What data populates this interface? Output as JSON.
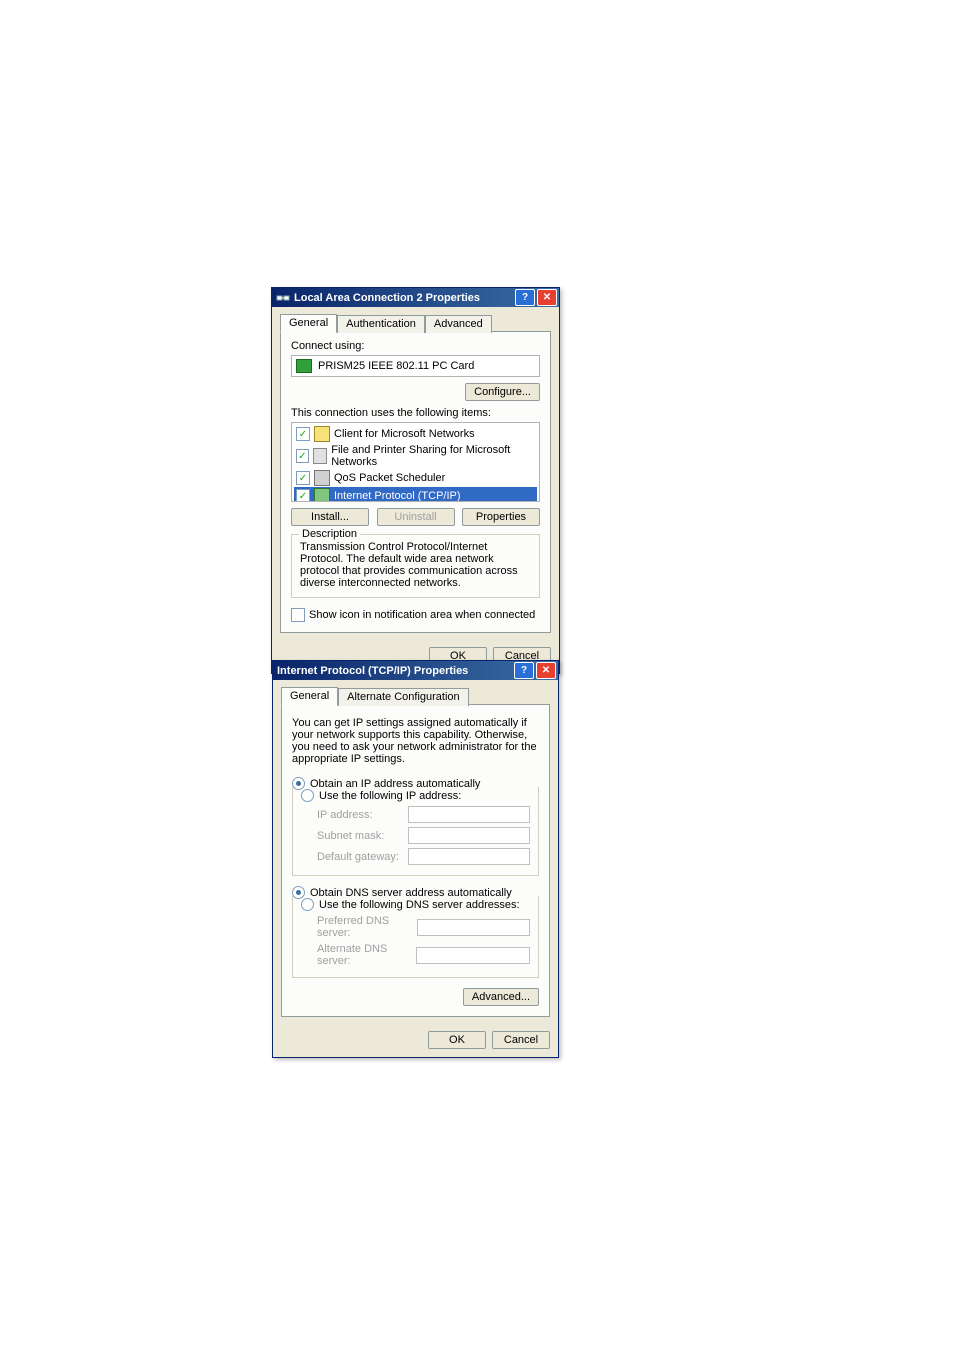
{
  "dialog1": {
    "title": "Local Area Connection 2 Properties",
    "tabs": {
      "general": "General",
      "auth": "Authentication",
      "adv": "Advanced"
    },
    "connect_using_label": "Connect using:",
    "adapter": "PRISM25 IEEE 802.11 PC Card",
    "configure_btn": "Configure...",
    "items_label": "This connection uses the following items:",
    "items": [
      {
        "label": "Client for Microsoft Networks"
      },
      {
        "label": "File and Printer Sharing for Microsoft Networks"
      },
      {
        "label": "QoS Packet Scheduler"
      },
      {
        "label": "Internet Protocol (TCP/IP)"
      }
    ],
    "install_btn": "Install...",
    "uninstall_btn": "Uninstall",
    "properties_btn": "Properties",
    "desc_legend": "Description",
    "desc_text": "Transmission Control Protocol/Internet Protocol. The default wide area network protocol that provides communication across diverse interconnected networks.",
    "show_icon": "Show icon in notification area when connected",
    "ok": "OK",
    "cancel": "Cancel"
  },
  "dialog2": {
    "title": "Internet Protocol (TCP/IP) Properties",
    "tabs": {
      "general": "General",
      "alt": "Alternate Configuration"
    },
    "intro": "You can get IP settings assigned automatically if your network supports this capability. Otherwise, you need to ask your network administrator for the appropriate IP settings.",
    "obtain_ip": "Obtain an IP address automatically",
    "use_ip": "Use the following IP address:",
    "ip_address": "IP address:",
    "subnet": "Subnet mask:",
    "gateway": "Default gateway:",
    "obtain_dns": "Obtain DNS server address automatically",
    "use_dns": "Use the following DNS server addresses:",
    "pref_dns": "Preferred DNS server:",
    "alt_dns": "Alternate DNS server:",
    "advanced_btn": "Advanced...",
    "ok": "OK",
    "cancel": "Cancel"
  }
}
